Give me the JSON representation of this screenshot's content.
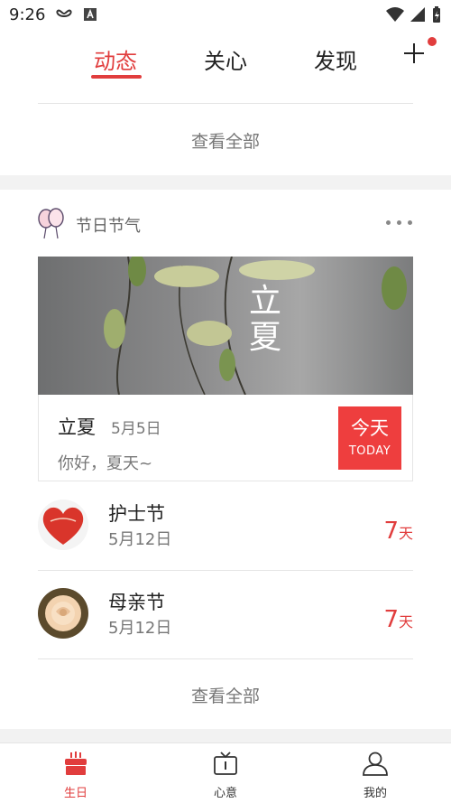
{
  "status_bar": {
    "time": "9:26"
  },
  "tabs": [
    {
      "label": "动态",
      "active": true
    },
    {
      "label": "关心",
      "active": false
    },
    {
      "label": "发现",
      "active": false
    }
  ],
  "top_section": {
    "view_all": "查看全部"
  },
  "holiday_section": {
    "title": "节日节气",
    "banner_text": "立夏",
    "featured": {
      "name": "立夏",
      "date": "5月5日",
      "greeting": "你好，夏天~",
      "badge_main": "今天",
      "badge_sub": "TODAY"
    },
    "items": [
      {
        "name": "护士节",
        "date": "5月12日",
        "count": "7",
        "unit": "天"
      },
      {
        "name": "母亲节",
        "date": "5月12日",
        "count": "7",
        "unit": "天"
      }
    ],
    "view_all": "查看全部"
  },
  "bottom_nav": [
    {
      "label": "生日",
      "icon": "cake-icon",
      "active": true
    },
    {
      "label": "心意",
      "icon": "gift-tv-icon",
      "active": false
    },
    {
      "label": "我的",
      "icon": "user-icon",
      "active": false
    }
  ],
  "colors": {
    "accent": "#e13d3d",
    "badge": "#ee3e3e"
  }
}
